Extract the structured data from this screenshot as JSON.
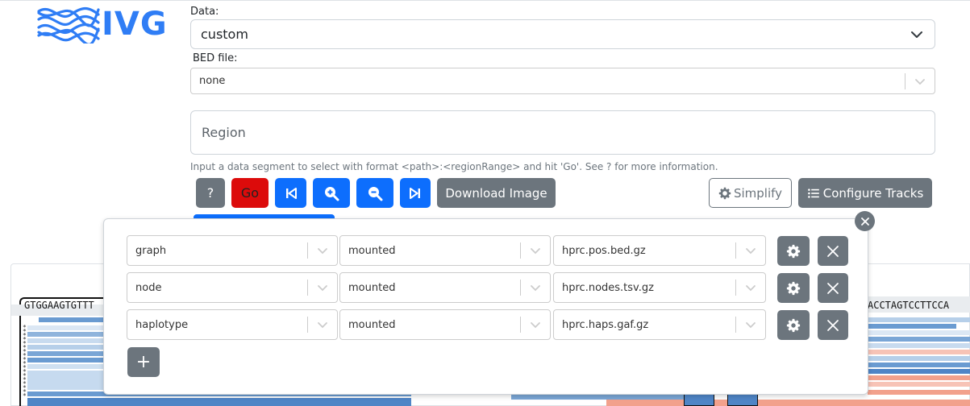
{
  "logo": {
    "text": "IVG"
  },
  "data_field": {
    "label": "Data:",
    "value": "custom"
  },
  "bed_field": {
    "label": "BED file:",
    "value": "none"
  },
  "region": {
    "placeholder": "Region"
  },
  "help_text": "Input a data segment to select with format <path>:<regionRange> and hit 'Go'. See ? for more information.",
  "toolbar": {
    "help_label": "?",
    "go_label": "Go",
    "download_label": "Download Image",
    "simplify_label": "Simplify",
    "configure_label": "Configure Tracks"
  },
  "sequence": {
    "left": "GTGGAAGTGTTT",
    "right": "ACCTAGTCCTTCCA"
  },
  "tracks": [
    {
      "type": "graph",
      "status": "mounted",
      "file": "hprc.pos.bed.gz"
    },
    {
      "type": "node",
      "status": "mounted",
      "file": "hprc.nodes.tsv.gz"
    },
    {
      "type": "haplotype",
      "status": "mounted",
      "file": "hprc.haps.gaf.gz"
    }
  ],
  "add_track_label": "+",
  "colors": {
    "accent": "#0d6efd",
    "go": "#dc0b0b",
    "secondary": "#6c757d",
    "logo": "#2f7df5"
  }
}
